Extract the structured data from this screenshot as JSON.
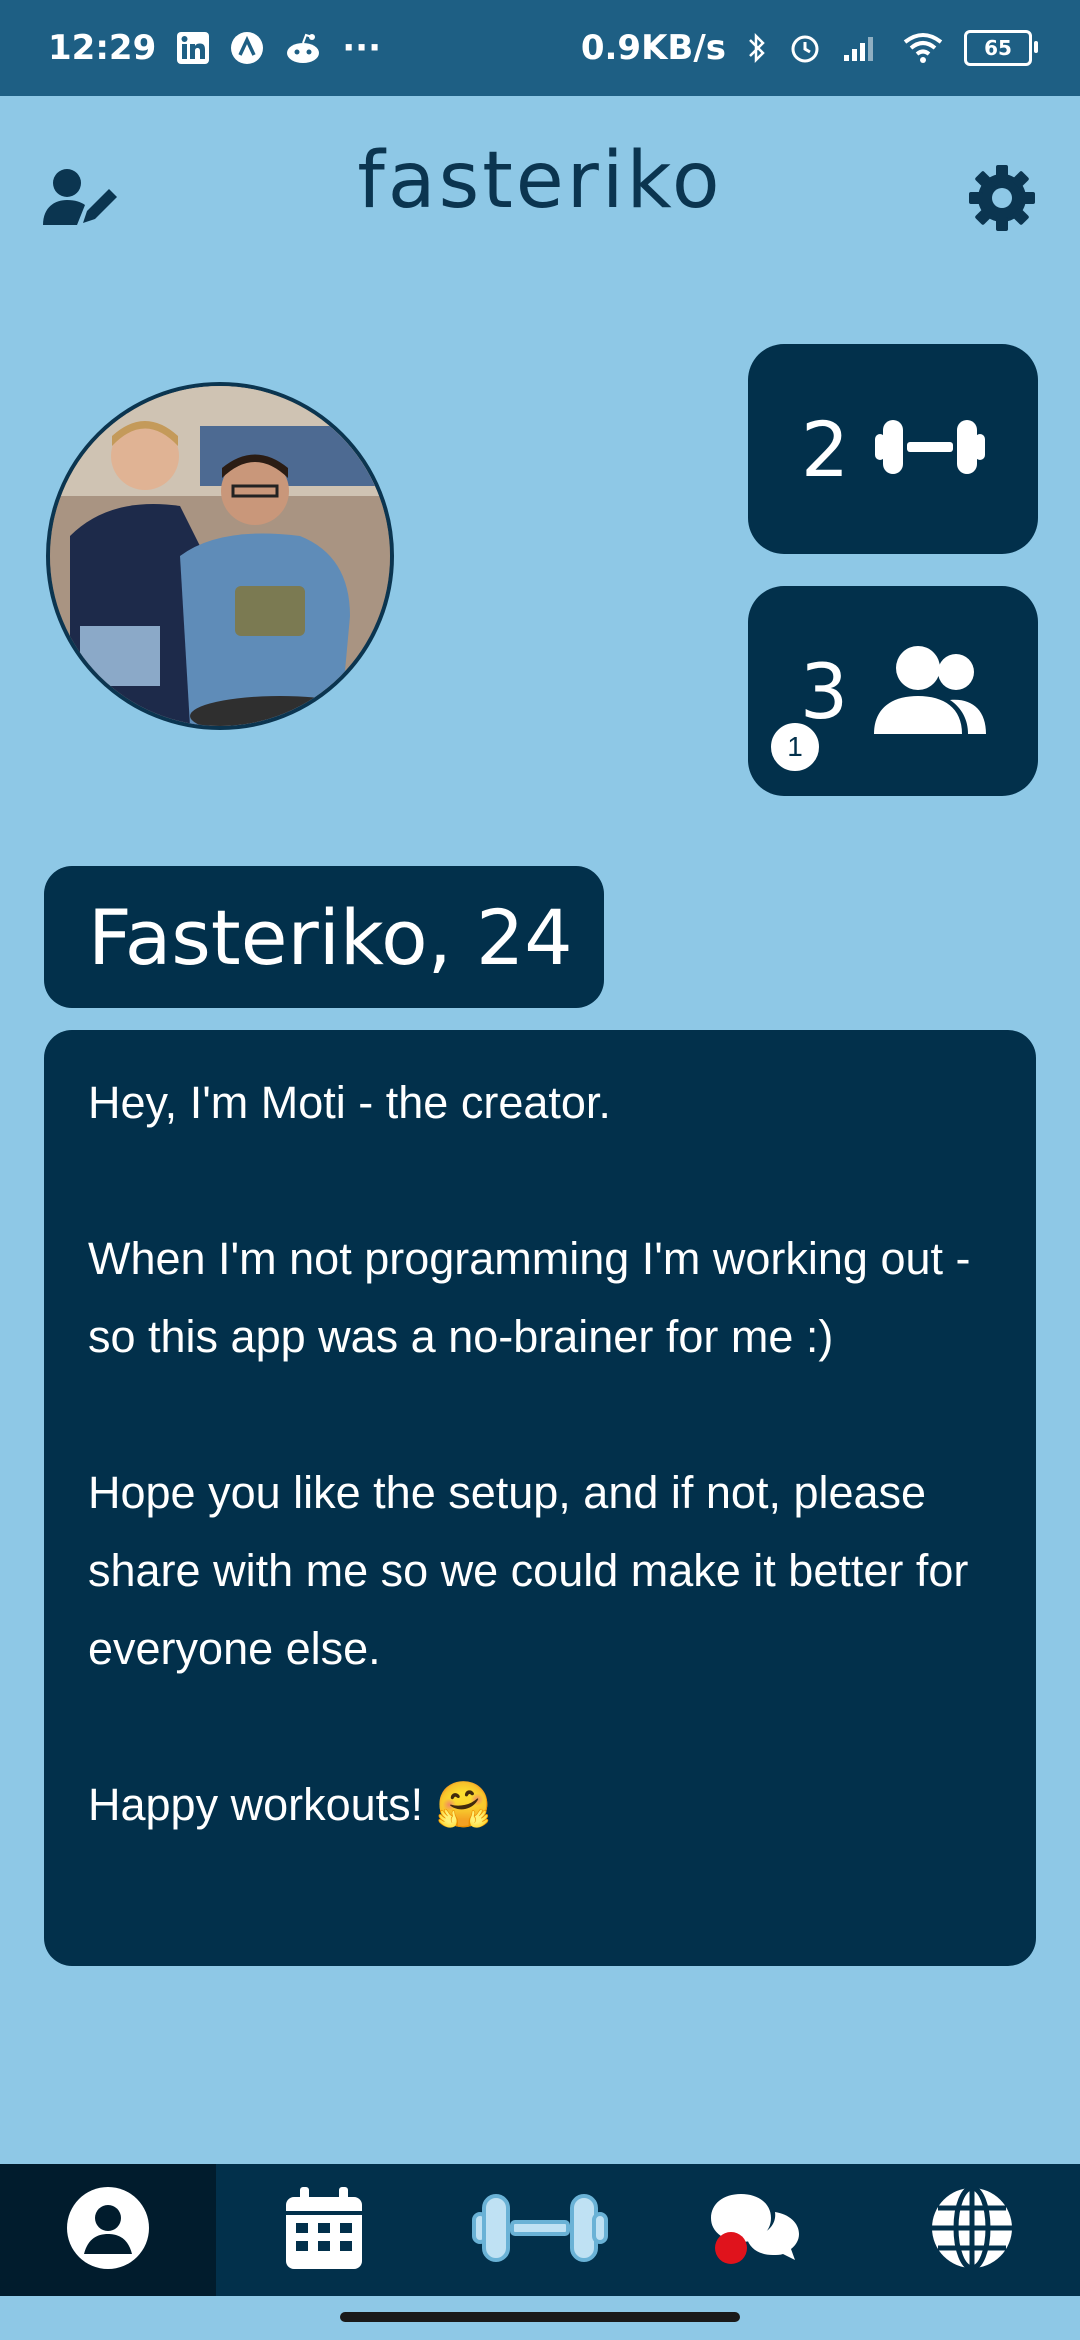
{
  "status_bar": {
    "time": "12:29",
    "more": "···",
    "speed": "0.9KB/s",
    "battery": "65",
    "icons": [
      "linkedin-icon",
      "app-a-icon",
      "reddit-icon",
      "bluetooth-icon",
      "alarm-icon",
      "signal-icon",
      "wifi-icon",
      "battery-icon"
    ]
  },
  "header": {
    "title": "fasteriko",
    "left_icon": "edit-profile-icon",
    "right_icon": "gear-icon"
  },
  "profile": {
    "photo_icon": "profile-photo",
    "workouts_count": "2",
    "friends_count": "3",
    "friends_badge": "1",
    "name_age": "Fasteriko, 24",
    "bio": {
      "line1": "Hey, I'm Moti - the creator.",
      "para2": "When I'm not programming I'm working out - so this app was a no-brainer for me :)",
      "para3": "Hope you like the setup, and if not, please share with me so we could make it better for everyone else.",
      "para4": "Happy workouts! 🤗"
    }
  },
  "nav": {
    "items": [
      "profile-icon",
      "calendar-icon",
      "dumbbell-icon",
      "chat-icon",
      "globe-icon"
    ],
    "active": "profile-icon",
    "chat_dot_color": "#e0131c"
  },
  "colors": {
    "background": "#8ec8e6",
    "card": "#02304b",
    "statusbar": "#1e5f84",
    "title": "#0b3550"
  }
}
